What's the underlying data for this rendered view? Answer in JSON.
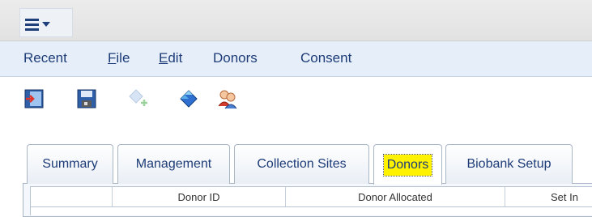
{
  "menu_button": {
    "icon": "hamburger-menu-icon"
  },
  "menubar": {
    "items": [
      {
        "label": "Recent"
      },
      {
        "label": "File",
        "accel": "F",
        "rest": "ile"
      },
      {
        "label": "Edit",
        "accel": "E",
        "rest": "dit"
      },
      {
        "label": "Donors"
      },
      {
        "label": "Consent"
      }
    ]
  },
  "toolbar": {
    "buttons": [
      {
        "icon": "exit-door-icon"
      },
      {
        "icon": "save-floppy-icon"
      },
      {
        "icon": "add-diamond-icon",
        "disabled": true
      },
      {
        "icon": "diamond-icon"
      },
      {
        "icon": "users-icon"
      }
    ]
  },
  "tabs": {
    "items": [
      "Summary",
      "Management",
      "Collection Sites",
      "Donors",
      "Biobank Setup"
    ],
    "active": "Donors"
  },
  "grid": {
    "columns": [
      "",
      "Donor ID",
      "Donor Allocated",
      "Set In"
    ]
  },
  "colors": {
    "accent": "#1d3c78",
    "highlight": "#fff200",
    "menubar_bg": "#e6eef9"
  }
}
